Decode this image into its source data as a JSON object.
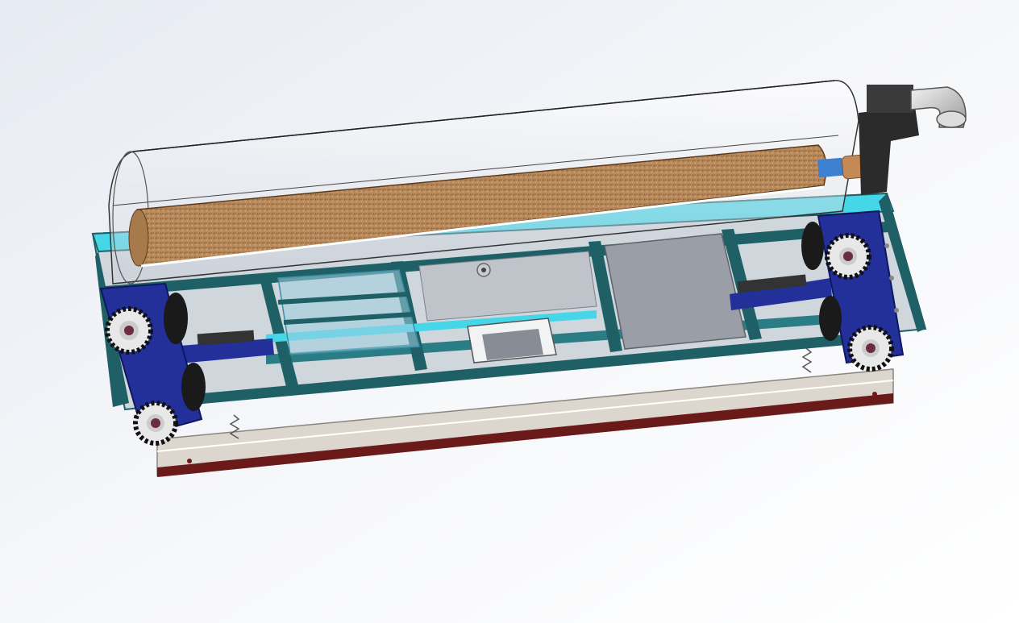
{
  "scene": {
    "kind": "3d-cad-render",
    "colors": {
      "background_top": "#e6eaf2",
      "background_bottom": "#ffffff",
      "frame": "#1f5f66",
      "frame_highlight": "#45d6e8",
      "wheel_bracket": "#23309a",
      "roller": "#b88a5c",
      "base_rail": "#dcd6ce",
      "base_edge": "#6b1a1a",
      "panel": "#9a9ea6",
      "cover": "#dfe3ea"
    },
    "components": [
      "transparent-cylinder-cover",
      "brush-roller",
      "drive-motor",
      "elbow-pipe",
      "frame",
      "wheel-assembly-left",
      "wheel-assembly-right",
      "base-rail",
      "control-box",
      "panel"
    ]
  }
}
